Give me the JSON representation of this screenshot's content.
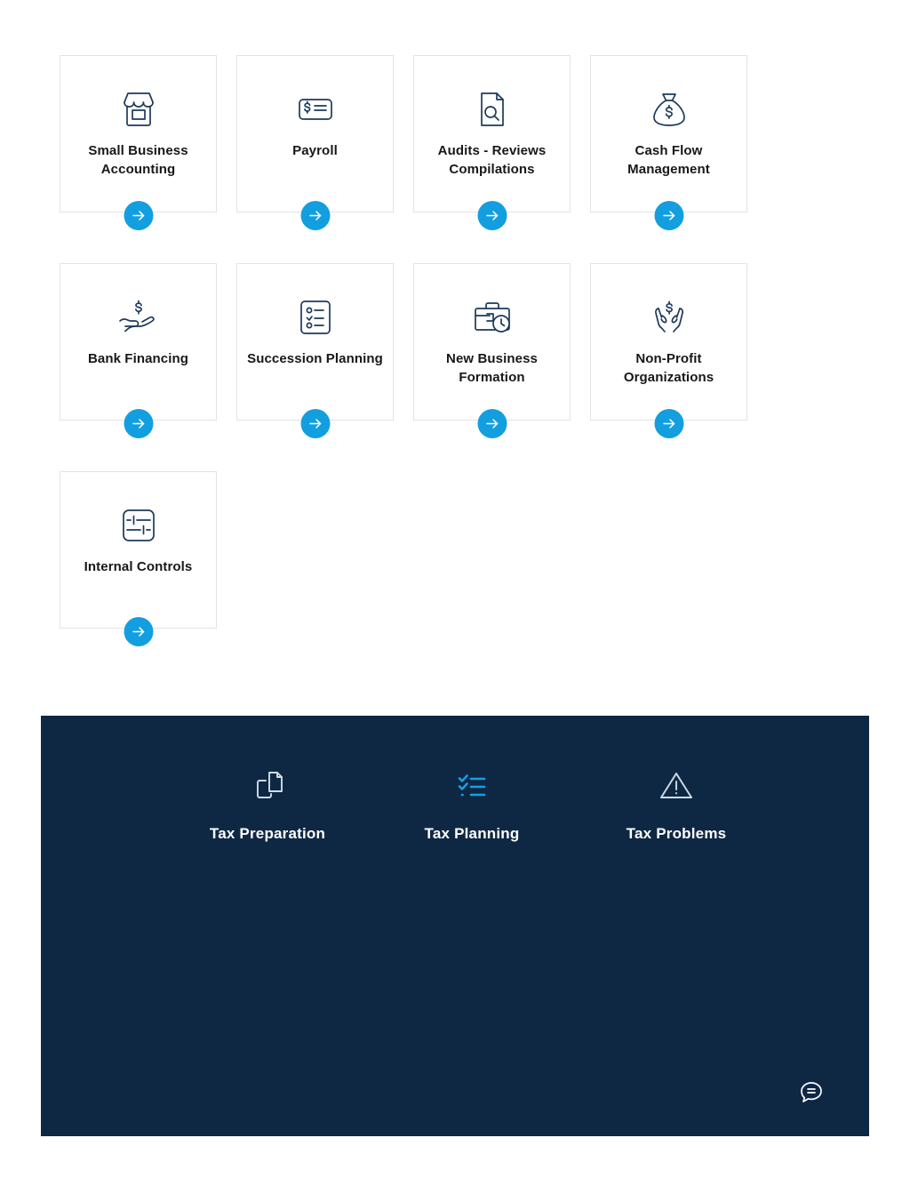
{
  "colors": {
    "icon_navy": "#1d3a5c",
    "accent_blue": "#139fdf",
    "dark_panel": "#0e2844",
    "card_border": "#e3e3e3",
    "title_text": "#181818",
    "light_icon": "#cfdde8"
  },
  "services": {
    "rows": [
      [
        {
          "title": "Small Business Accounting",
          "icon": "storefront-icon",
          "arrow_label": "arrow-right-icon"
        },
        {
          "title": "Payroll",
          "icon": "paycheck-icon",
          "arrow_label": "arrow-right-icon"
        },
        {
          "title": "Audits - Reviews Compilations",
          "icon": "document-search-icon",
          "arrow_label": "arrow-right-icon"
        },
        {
          "title": "Cash Flow Management",
          "icon": "money-bag-icon",
          "arrow_label": "arrow-right-icon"
        }
      ],
      [
        {
          "title": "Bank Financing",
          "icon": "hand-dollar-icon",
          "arrow_label": "arrow-right-icon"
        },
        {
          "title": "Succession Planning",
          "icon": "checklist-icon",
          "arrow_label": "arrow-right-icon"
        },
        {
          "title": "New Business Formation",
          "icon": "briefcase-clock-icon",
          "arrow_label": "arrow-right-icon"
        },
        {
          "title": "Non-Profit Organizations",
          "icon": "hands-dollar-icon",
          "arrow_label": "arrow-right-icon"
        }
      ],
      [
        {
          "title": "Internal Controls",
          "icon": "sliders-icon",
          "arrow_label": "arrow-right-icon"
        }
      ]
    ]
  },
  "tax_section": {
    "items": [
      {
        "title": "Tax Preparation",
        "icon": "copy-documents-icon"
      },
      {
        "title": "Tax Planning",
        "icon": "checklist-blue-icon"
      },
      {
        "title": "Tax Problems",
        "icon": "warning-triangle-icon"
      }
    ],
    "chat_icon": "chat-bubble-icon"
  }
}
